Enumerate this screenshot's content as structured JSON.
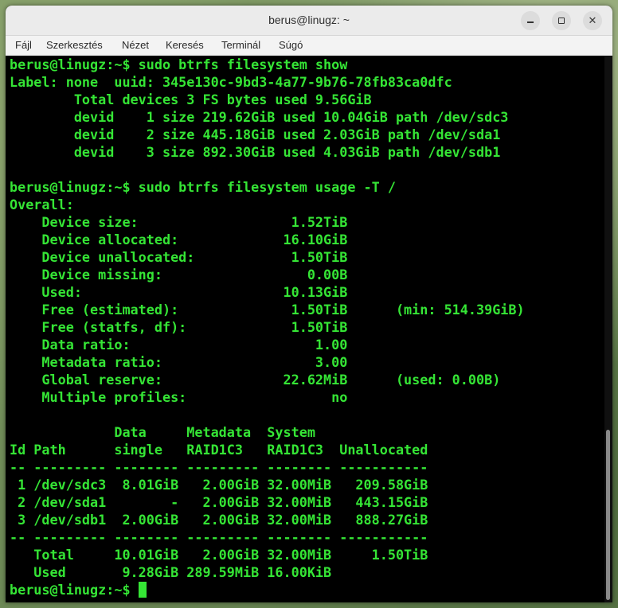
{
  "window": {
    "title": "berus@linugz: ~"
  },
  "menu": {
    "items": [
      "Fájl",
      "Szerkesztés",
      "Nézet",
      "Keresés",
      "Terminál",
      "Súgó"
    ]
  },
  "terminal": {
    "lines": [
      "berus@linugz:~$ sudo btrfs filesystem show",
      "Label: none  uuid: 345e130c-9bd3-4a77-9b76-78fb83ca0dfc",
      "        Total devices 3 FS bytes used 9.56GiB",
      "        devid    1 size 219.62GiB used 10.04GiB path /dev/sdc3",
      "        devid    2 size 445.18GiB used 2.03GiB path /dev/sda1",
      "        devid    3 size 892.30GiB used 4.03GiB path /dev/sdb1",
      "",
      "berus@linugz:~$ sudo btrfs filesystem usage -T /",
      "Overall:",
      "    Device size:                   1.52TiB",
      "    Device allocated:             16.10GiB",
      "    Device unallocated:            1.50TiB",
      "    Device missing:                  0.00B",
      "    Used:                         10.13GiB",
      "    Free (estimated):              1.50TiB      (min: 514.39GiB)",
      "    Free (statfs, df):             1.50TiB",
      "    Data ratio:                       1.00",
      "    Metadata ratio:                   3.00",
      "    Global reserve:               22.62MiB      (used: 0.00B)",
      "    Multiple profiles:                  no",
      "",
      "             Data     Metadata  System",
      "Id Path      single   RAID1C3   RAID1C3  Unallocated",
      "-- --------- -------- --------- -------- -----------",
      " 1 /dev/sdc3  8.01GiB   2.00GiB 32.00MiB   209.58GiB",
      " 2 /dev/sda1        -   2.00GiB 32.00MiB   443.15GiB",
      " 3 /dev/sdb1  2.00GiB   2.00GiB 32.00MiB   888.27GiB",
      "-- --------- -------- --------- -------- -----------",
      "   Total     10.01GiB   2.00GiB 32.00MiB     1.50TiB",
      "   Used       9.28GiB 289.59MiB 16.00KiB",
      "berus@linugz:~$ "
    ]
  },
  "colors": {
    "terminal_fg": "#35e535",
    "terminal_bg": "#000000",
    "titlebar_bg": "#ebebeb"
  },
  "icons": {
    "minimize": "minimize-icon",
    "maximize": "maximize-icon",
    "close": "close-icon"
  }
}
